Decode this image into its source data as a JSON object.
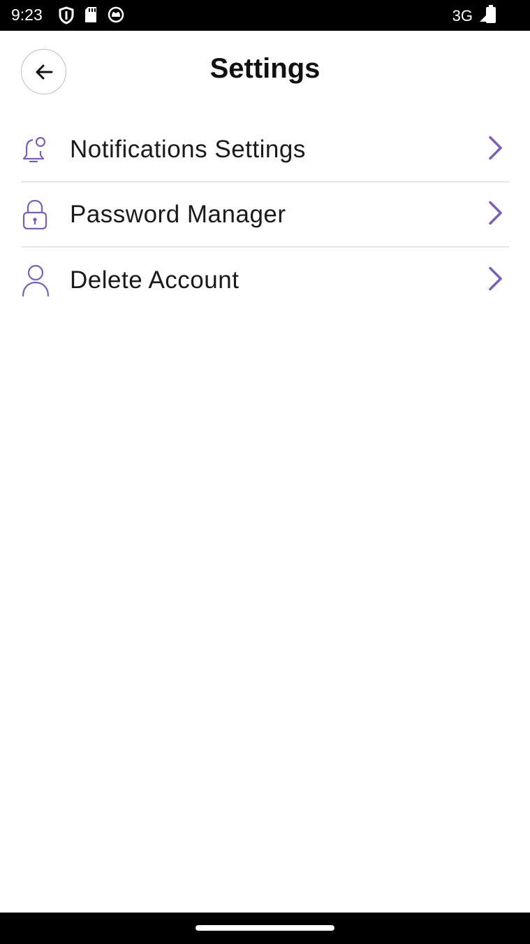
{
  "status_bar": {
    "time": "9:23",
    "network": "3G",
    "icons": [
      "shield-icon",
      "sd-card-icon",
      "cat-face-icon",
      "signal-icon",
      "battery-icon"
    ]
  },
  "header": {
    "title": "Settings",
    "back_icon": "arrow-left-icon"
  },
  "settings": {
    "items": [
      {
        "label": "Notifications Settings",
        "icon": "bell-icon"
      },
      {
        "label": "Password Manager",
        "icon": "lock-icon"
      },
      {
        "label": "Delete Account",
        "icon": "user-icon"
      }
    ]
  },
  "colors": {
    "accent": "#7b5fb5",
    "divider": "#e6e6e6",
    "text": "#1a1a1a"
  }
}
